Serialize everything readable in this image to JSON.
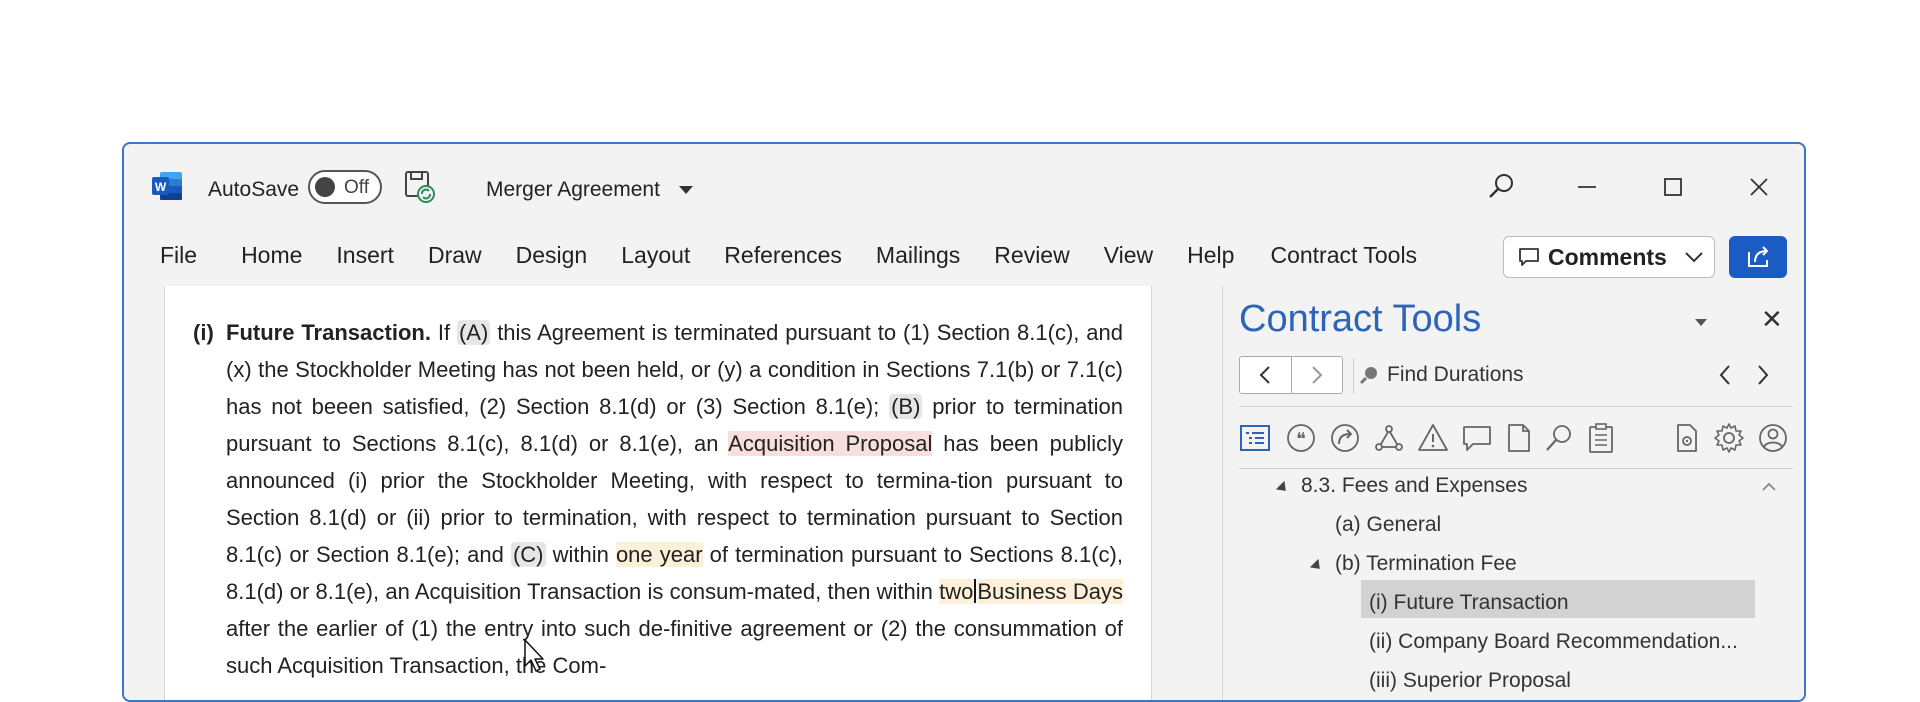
{
  "titlebar": {
    "app_icon": "word-logo",
    "autosave_label": "AutoSave",
    "autosave_state": "Off",
    "document_title": "Merger Agreement"
  },
  "ribbon": {
    "tabs": [
      "File",
      "Home",
      "Insert",
      "Draw",
      "Design",
      "Layout",
      "References",
      "Mailings",
      "Review",
      "View",
      "Help",
      "Contract Tools"
    ],
    "comments_label": "Comments"
  },
  "document": {
    "para_number": "(i)",
    "heading": "Future Transaction.",
    "t1": " If ",
    "a": "(A)",
    "t2": " this Agreement is terminated pursuant to (1) Section 8.1(c), and (x) the Stockholder Meeting has not been held, or (y) a condition in Sections 7.1(b) or 7.1(c) has not beeen satisfied, (2) Section 8.1(d) or (3) Section 8.1(e); ",
    "b": "(B)",
    "t3": " prior to termination pursuant to Sections 8.1(c), 8.1(d) or 8.1(e), an ",
    "acq_proposal": "Acquisition Proposal",
    "t4": " has been publicly announced (i) prior the Stockholder Meeting, with respect to termina-tion pursuant to Section 8.1(d) or (ii) prior to termination, with respect to termination pursuant to Section 8.1(c) or Section 8.1(e); and ",
    "c": "(C)",
    "t5": " within ",
    "one_year": "one year",
    "t6": " of termination pursuant to Sections 8.1(c), 8.1(d) or 8.1(e), an Acquisition Transaction is consum-mated, then within ",
    "two": "two",
    "business_days": "Business Days",
    "t7": " after the earlier of (1) the entry into such de-finitive agreement or (2) the consummation of such Acquisition Transaction, the Com-"
  },
  "pane": {
    "title": "Contract Tools",
    "find_label": "Find Durations",
    "tools": [
      "outline-icon",
      "quote-icon",
      "redirect-icon",
      "network-icon",
      "warning-icon",
      "comment-icon",
      "document-icon",
      "search-icon",
      "clipboard-icon",
      "doc-settings-icon",
      "gear-icon",
      "account-icon"
    ],
    "tree": [
      {
        "label": "8.3. Fees and Expenses",
        "level": 0,
        "expanded": true
      },
      {
        "label": "(a) General",
        "level": 1
      },
      {
        "label": "(b) Termination Fee",
        "level": 1,
        "expanded": true
      },
      {
        "label": "(i) Future Transaction",
        "level": 2,
        "selected": true
      },
      {
        "label": "(ii) Company Board Recommendation...",
        "level": 2
      },
      {
        "label": "(iii) Superior Proposal",
        "level": 2
      }
    ]
  },
  "colors": {
    "accent": "#2b64b8",
    "share_button": "#1a5bc4",
    "highlight_grey": "#e6e6e6",
    "highlight_red": "#f9dede",
    "highlight_yellow": "#fdf0d8",
    "selection": "#d2d2d2"
  }
}
